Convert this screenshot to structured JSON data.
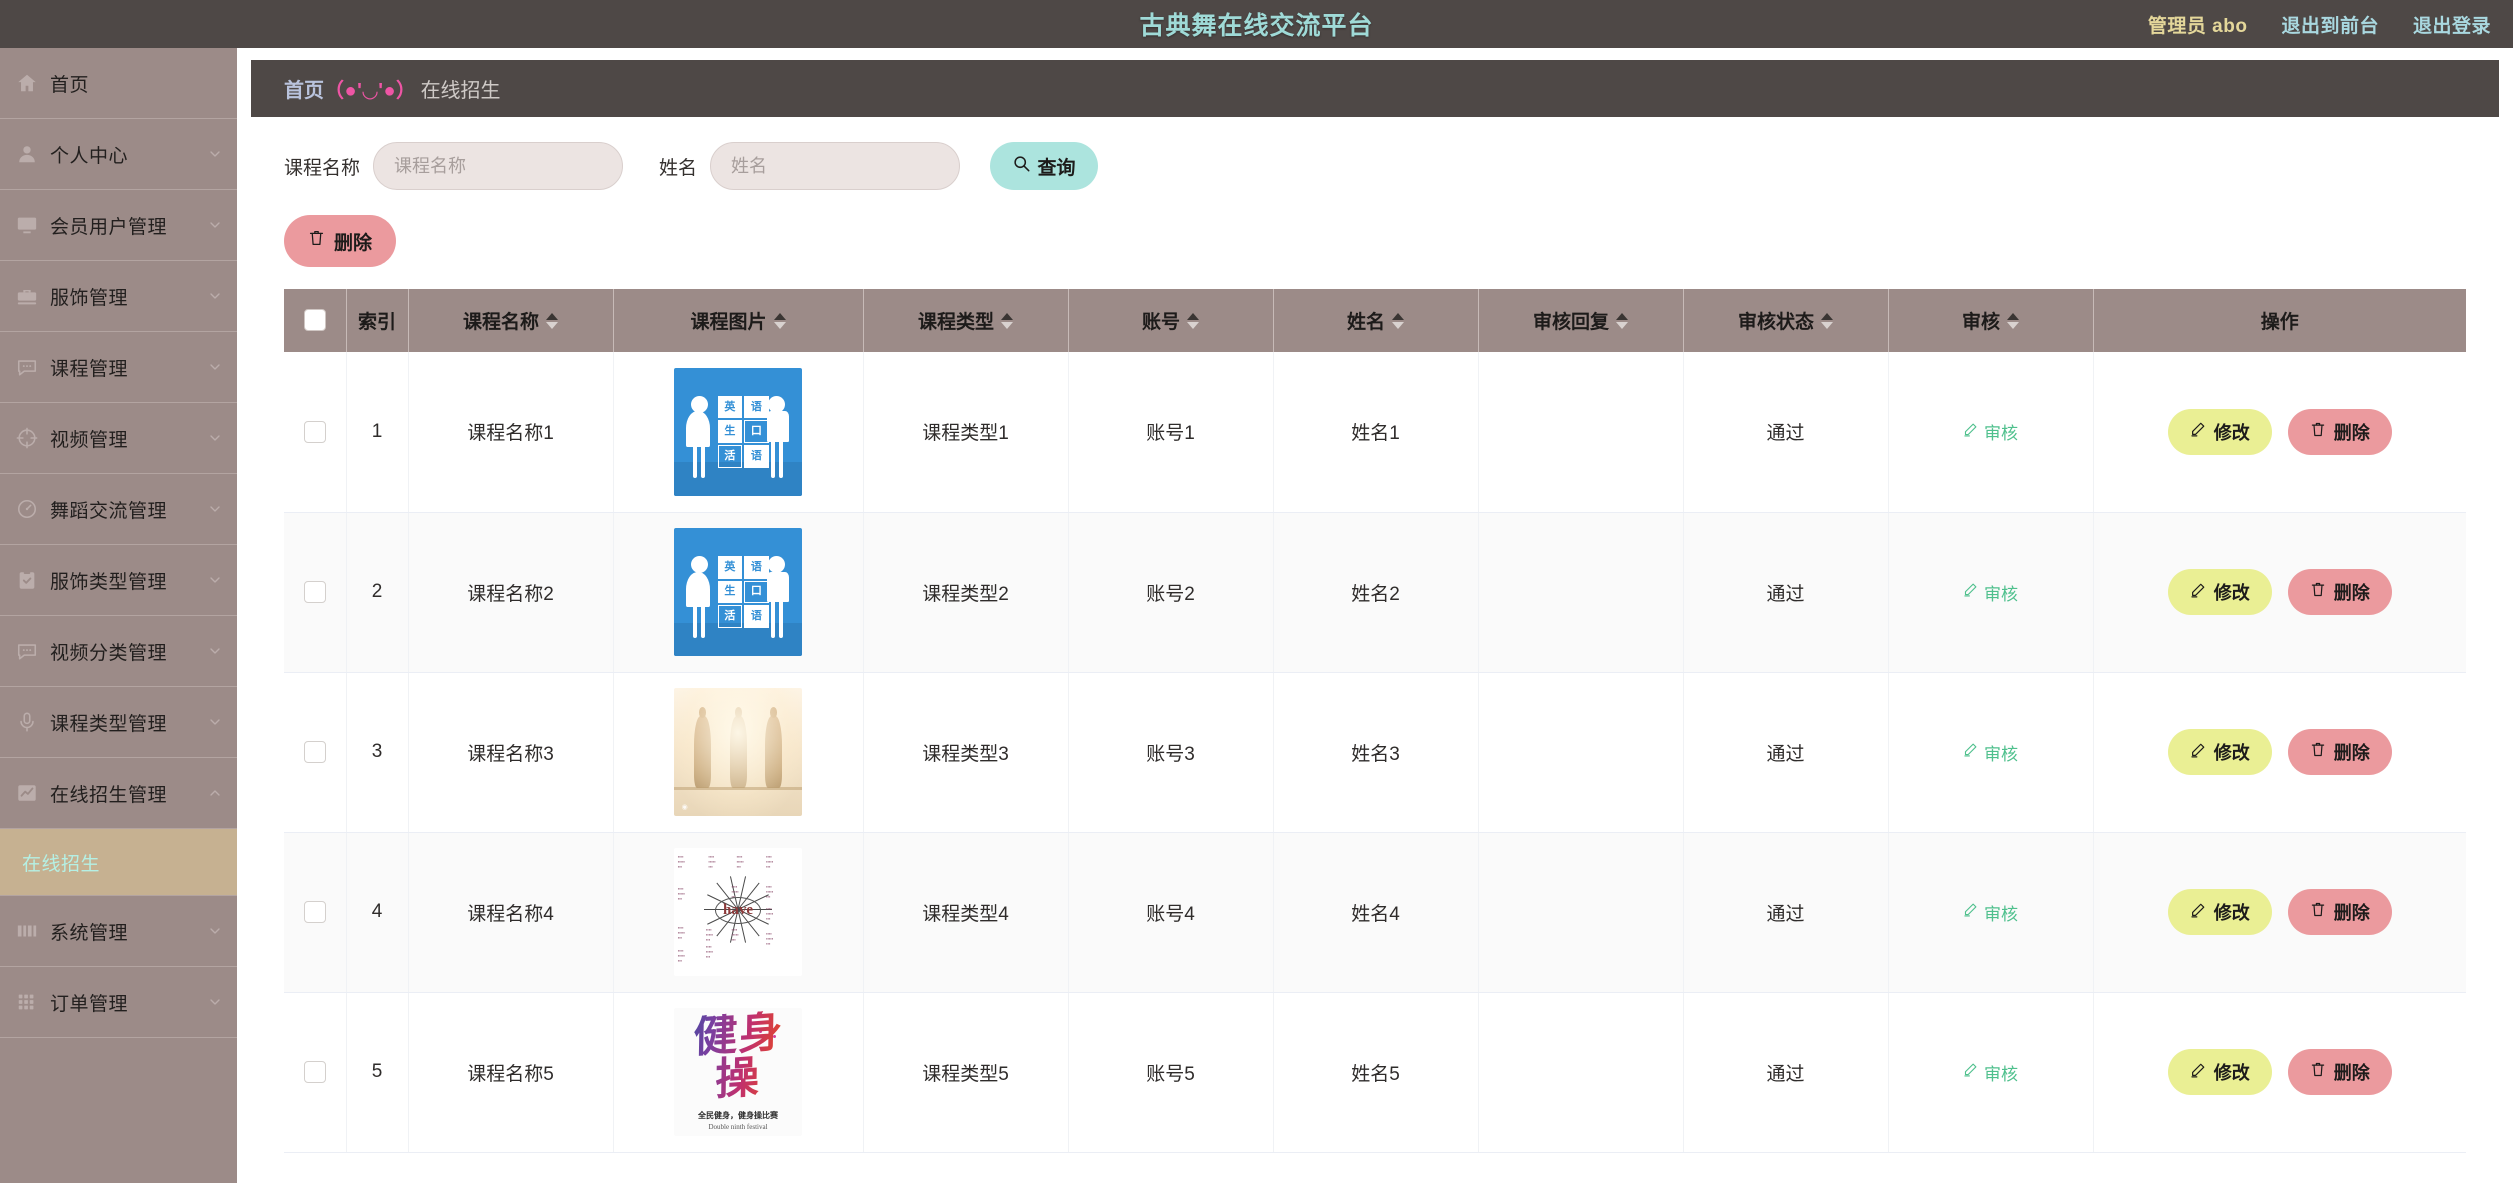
{
  "topbar": {
    "title": "古典舞在线交流平台",
    "user_label": "管理员 abo",
    "links": [
      "退出到前台",
      "退出登录"
    ],
    "bg_color": "#4e4846",
    "title_color": "#9fdad7",
    "user_color": "#e4d79a",
    "link_color": "#a9d8e0"
  },
  "sidebar": {
    "bg_color": "#9c8b88",
    "active_bg_color": "#c6b191",
    "active_text_color": "#b5f0e4",
    "items": [
      {
        "label": "首页",
        "icon": "home-icon",
        "expandable": false
      },
      {
        "label": "个人中心",
        "icon": "user-icon",
        "expandable": true
      },
      {
        "label": "会员用户管理",
        "icon": "monitor-icon",
        "expandable": true
      },
      {
        "label": "服饰管理",
        "icon": "briefcase-icon",
        "expandable": true
      },
      {
        "label": "课程管理",
        "icon": "chat-icon",
        "expandable": true
      },
      {
        "label": "视频管理",
        "icon": "target-icon",
        "expandable": true
      },
      {
        "label": "舞蹈交流管理",
        "icon": "gauge-icon",
        "expandable": true
      },
      {
        "label": "服饰类型管理",
        "icon": "clipboard-check-icon",
        "expandable": true
      },
      {
        "label": "视频分类管理",
        "icon": "chat-icon",
        "expandable": true
      },
      {
        "label": "课程类型管理",
        "icon": "microphone-icon",
        "expandable": true
      },
      {
        "label": "在线招生管理",
        "icon": "chart-line-icon",
        "expandable": true,
        "expanded": true,
        "children": [
          {
            "label": "在线招生",
            "active": true
          }
        ]
      },
      {
        "label": "系统管理",
        "icon": "grid-bars-icon",
        "expandable": true
      },
      {
        "label": "订单管理",
        "icon": "dots-grid-icon",
        "expandable": true
      }
    ]
  },
  "breadcrumb": {
    "home": "首页",
    "emoji": "（●'◡'●）",
    "current": "在线招生"
  },
  "search": {
    "course_name_label": "课程名称",
    "course_name_placeholder": "课程名称",
    "course_name_value": "",
    "name_label": "姓名",
    "name_placeholder": "姓名",
    "name_value": "",
    "query_button": "查询",
    "query_button_color": "#ace4de"
  },
  "toolbar": {
    "delete_label": "删除",
    "delete_color": "#eb9a9e"
  },
  "table": {
    "columns": [
      {
        "key": "checkbox",
        "label": "",
        "sortable": false
      },
      {
        "key": "index",
        "label": "索引",
        "sortable": false
      },
      {
        "key": "course_name",
        "label": "课程名称",
        "sortable": true
      },
      {
        "key": "course_image",
        "label": "课程图片",
        "sortable": true
      },
      {
        "key": "course_type",
        "label": "课程类型",
        "sortable": true
      },
      {
        "key": "account",
        "label": "账号",
        "sortable": true
      },
      {
        "key": "name",
        "label": "姓名",
        "sortable": true
      },
      {
        "key": "audit_reply",
        "label": "审核回复",
        "sortable": true
      },
      {
        "key": "audit_status",
        "label": "审核状态",
        "sortable": true
      },
      {
        "key": "audit",
        "label": "审核",
        "sortable": true
      },
      {
        "key": "operations",
        "label": "操作",
        "sortable": false
      }
    ],
    "header_bg": "#9c8b88",
    "rows": [
      {
        "index": "1",
        "course_name": "课程名称1",
        "image": "english-poster",
        "course_type": "课程类型1",
        "account": "账号1",
        "name": "姓名1",
        "audit_reply": "",
        "audit_status": "通过",
        "audit_link": "审核"
      },
      {
        "index": "2",
        "course_name": "课程名称2",
        "image": "english-poster",
        "course_type": "课程类型2",
        "account": "账号2",
        "name": "姓名2",
        "audit_reply": "",
        "audit_status": "通过",
        "audit_link": "审核"
      },
      {
        "index": "3",
        "course_name": "课程名称3",
        "image": "yoga-photo",
        "course_type": "课程类型3",
        "account": "账号3",
        "name": "姓名3",
        "audit_reply": "",
        "audit_status": "通过",
        "audit_link": "审核"
      },
      {
        "index": "4",
        "course_name": "课程名称4",
        "image": "have-mindmap",
        "course_type": "课程类型4",
        "account": "账号4",
        "name": "姓名4",
        "audit_reply": "",
        "audit_status": "通过",
        "audit_link": "审核"
      },
      {
        "index": "5",
        "course_name": "课程名称5",
        "image": "fitness-calligraphy",
        "course_type": "课程类型5",
        "account": "账号5",
        "name": "姓名5",
        "audit_reply": "",
        "audit_status": "通过",
        "audit_link": "审核"
      }
    ],
    "row_actions": {
      "edit_label": "修改",
      "edit_color": "#eaef94",
      "delete_label": "删除",
      "delete_color": "#eb9a9e",
      "audit_color": "#4fc08d"
    }
  },
  "images": {
    "english-poster": {
      "chars": [
        "英",
        "语",
        "生",
        "口",
        "活",
        "语"
      ],
      "bg": "#3490d6"
    },
    "fitness-calligraphy": {
      "title": "健身操",
      "sub1": "全民健身，健身操比赛",
      "sub2": "Double ninth festival"
    },
    "have-mindmap": {
      "center": "have"
    }
  }
}
